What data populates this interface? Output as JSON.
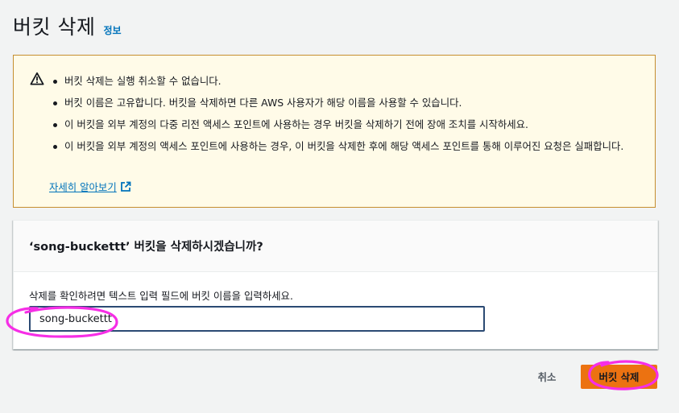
{
  "header": {
    "title": "버킷 삭제",
    "info_label": "정보"
  },
  "warning": {
    "icon": "warning-triangle-icon",
    "items": [
      "버킷 삭제는 실행 취소할 수 없습니다.",
      "버킷 이름은 고유합니다. 버킷을 삭제하면 다른 AWS 사용자가 해당 이름을 사용할 수 있습니다.",
      "이 버킷을 외부 계정의 다중 리전 액세스 포인트에 사용하는 경우 버킷을 삭제하기 전에 장애 조치를 시작하세요.",
      "이 버킷을 외부 계정의 액세스 포인트에 사용하는 경우, 이 버킷을 삭제한 후에 해당 액세스 포인트를 통해 이루어진 요청은 실패합니다."
    ],
    "learn_more_label": "자세히 알아보기",
    "learn_more_icon": "external-link-icon"
  },
  "confirm": {
    "heading": "‘song-buckettt’ 버킷을 삭제하시겠습니까?",
    "field_label": "삭제를 확인하려면 텍스트 입력 필드에 버킷 이름을 입력하세요.",
    "input_value": "song-buckettt"
  },
  "actions": {
    "cancel_label": "취소",
    "delete_label": "버킷 삭제"
  },
  "colors": {
    "primary_button": "#ec7211",
    "link": "#0073bb",
    "warning_bg": "#fffbe8",
    "warning_border": "#c58e2f",
    "annotation": "#f62ee6"
  }
}
